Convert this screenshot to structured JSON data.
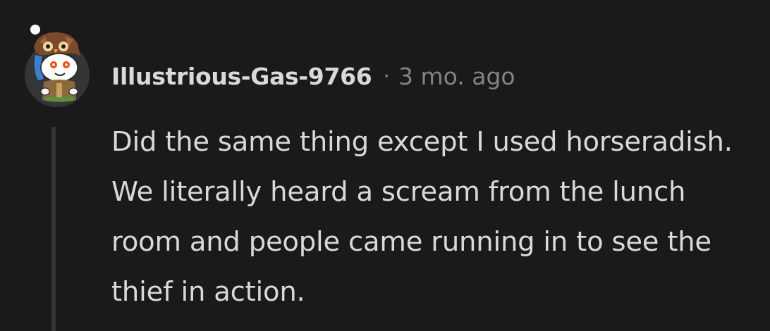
{
  "comment": {
    "avatar_icon": "snoo-owl-hood-avatar-icon",
    "username": "Illustrious-Gas-9766",
    "separator": "·",
    "timestamp": "3 mo. ago",
    "body": "Did the same thing except I used horseradish. We literally heard a scream from the lunch room and people came running in to see the thief in action."
  },
  "colors": {
    "background": "#1a1a1b",
    "text": "#d7dadc",
    "muted": "#818384",
    "thread_line": "#343536"
  }
}
